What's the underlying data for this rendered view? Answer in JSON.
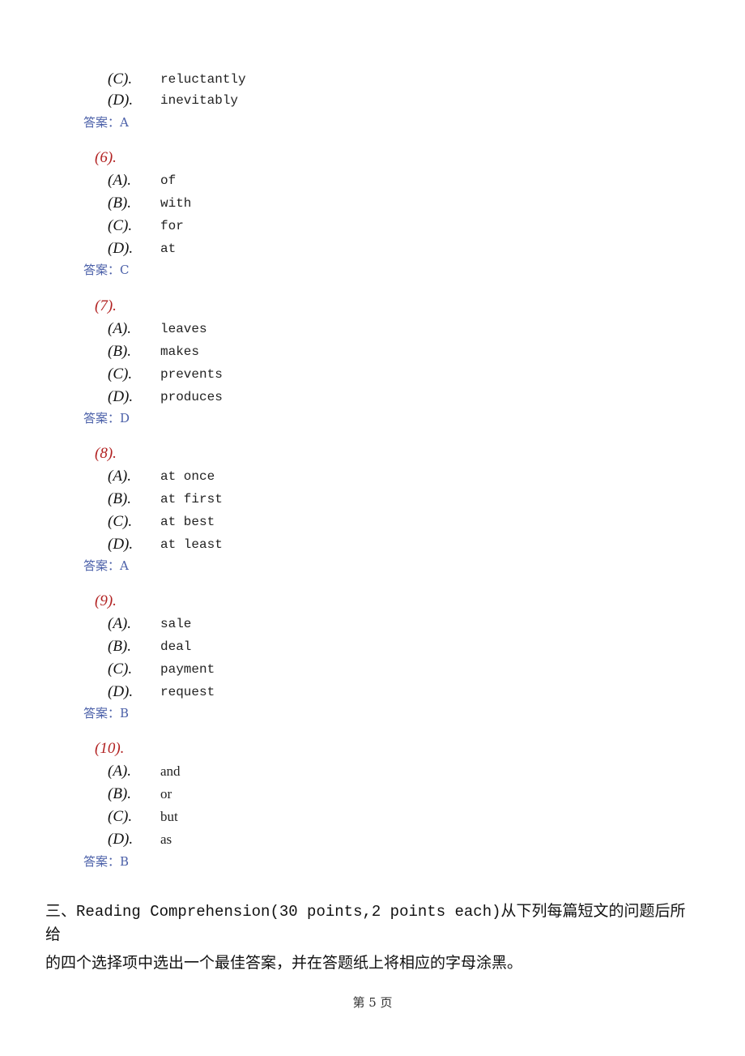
{
  "document": {
    "partial_question": {
      "options": [
        {
          "label": "(C).",
          "text": "reluctantly"
        },
        {
          "label": "(D).",
          "text": "inevitably"
        }
      ],
      "answer": "答案：A"
    },
    "questions": [
      {
        "number": "(6).",
        "options": [
          {
            "label": "(A).",
            "text": "of"
          },
          {
            "label": "(B).",
            "text": "with"
          },
          {
            "label": "(C).",
            "text": "for"
          },
          {
            "label": "(D).",
            "text": "at"
          }
        ],
        "answer": "答案：C"
      },
      {
        "number": "(7).",
        "options": [
          {
            "label": "(A).",
            "text": "leaves"
          },
          {
            "label": "(B).",
            "text": "makes"
          },
          {
            "label": "(C).",
            "text": "prevents"
          },
          {
            "label": "(D).",
            "text": "produces"
          }
        ],
        "answer": "答案：D"
      },
      {
        "number": "(8).",
        "options": [
          {
            "label": "(A).",
            "text": "at once"
          },
          {
            "label": "(B).",
            "text": "at first"
          },
          {
            "label": "(C).",
            "text": "at best"
          },
          {
            "label": "(D).",
            "text": "at least"
          }
        ],
        "answer": "答案：A"
      },
      {
        "number": "(9).",
        "options": [
          {
            "label": "(A).",
            "text": "sale"
          },
          {
            "label": "(B).",
            "text": "deal"
          },
          {
            "label": "(C).",
            "text": "payment"
          },
          {
            "label": "(D).",
            "text": "request"
          }
        ],
        "answer": "答案：B"
      },
      {
        "number": "(10).",
        "options": [
          {
            "label": "(A).",
            "text": "and"
          },
          {
            "label": "(B).",
            "text": "or"
          },
          {
            "label": "(C).",
            "text": "but"
          },
          {
            "label": "(D).",
            "text": "as"
          }
        ],
        "answer": "答案：B"
      }
    ],
    "section": {
      "prefix": "三、",
      "title": "Reading Comprehension(30 points,2 points each)",
      "line1_suffix": "从下列每篇短文的问题后所",
      "line2": "给",
      "line3": "的四个选择项中选出一个最佳答案，并在答题纸上将相应的字母涂黑。"
    },
    "footer": {
      "page_label": "第 5 页"
    }
  }
}
